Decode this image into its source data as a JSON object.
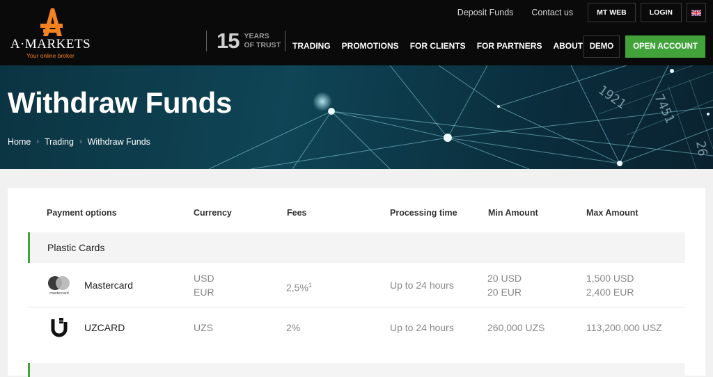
{
  "brand": {
    "name": "A·MARKETS",
    "tagline": "Your online broker",
    "logo_color": "#f58220"
  },
  "top_links": {
    "deposit": "Deposit Funds",
    "contact": "Contact us",
    "mt_web": "MT WEB",
    "login": "LOGIN",
    "language_icon": "uk-flag-icon"
  },
  "trust": {
    "number": "15",
    "line1": "YEARS",
    "line2": "OF TRUST"
  },
  "nav": {
    "items": [
      "TRADING",
      "PROMOTIONS",
      "FOR CLIENTS",
      "FOR PARTNERS",
      "ABOUT"
    ],
    "demo": "DEMO",
    "open_account": "OPEN ACCOUNT",
    "accent": "#41a33a"
  },
  "hero": {
    "title": "Withdraw Funds",
    "breadcrumb": [
      "Home",
      "Trading",
      "Withdraw Funds"
    ]
  },
  "table": {
    "headers": [
      "Payment options",
      "Currency",
      "Fees",
      "Processing time",
      "Min Amount",
      "Max Amount"
    ],
    "group": "Plastic Cards",
    "rows": [
      {
        "icon": "mastercard-icon",
        "icon_label": "mastercard",
        "name": "Mastercard",
        "currency": [
          "USD",
          "EUR"
        ],
        "fee": "2,5%",
        "fee_note": "1",
        "time": "Up to 24 hours",
        "min": [
          "20 USD",
          "20 EUR"
        ],
        "max": [
          "1,500 USD",
          "2,400 EUR"
        ]
      },
      {
        "icon": "uzcard-icon",
        "name": "UZCARD",
        "currency": [
          "UZS"
        ],
        "fee": "2%",
        "time": "Up to 24 hours",
        "min": [
          "260,000 UZS"
        ],
        "max": [
          "113,200,000 USZ"
        ]
      }
    ]
  }
}
